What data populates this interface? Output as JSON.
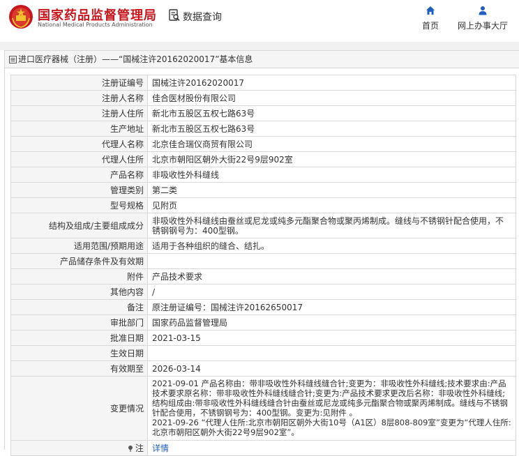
{
  "header": {
    "site_title": "国家药品监督管理局",
    "site_subtitle": "National Medical Products Administration",
    "query_label": "数据查询",
    "nav": [
      {
        "label": "首页",
        "icon": "home-icon"
      },
      {
        "label": "网上办事大厅",
        "icon": "user-icon"
      }
    ]
  },
  "panel": {
    "title": "进口医疗器械（注册）——“国械注许20162020017”基本信息",
    "rows": [
      {
        "key": "注册证编号",
        "value": "国械注许20162020017"
      },
      {
        "key": "注册人名称",
        "value": "佳合医材股份有限公司"
      },
      {
        "key": "注册人住所",
        "value": "新北市五股区五权七路63号"
      },
      {
        "key": "生产地址",
        "value": "新北市五股区五权七路63号"
      },
      {
        "key": "代理人名称",
        "value": "北京佳合瑞仪商贸有限公司"
      },
      {
        "key": "代理人住所",
        "value": "北京市朝阳区朝外大街22号9层902室"
      },
      {
        "key": "产品名称",
        "value": "非吸收性外科缝线"
      },
      {
        "key": "管理类别",
        "value": "第二类"
      },
      {
        "key": "型号规格",
        "value": "见附页"
      },
      {
        "key": "结构及组成/主要组成成分",
        "value": "非吸收性外科缝线由蚕丝或尼龙或纯多元酯聚合物或聚丙烯制成。缝线与不锈钢针配合使用，不锈钢钢号为：400型钢。"
      },
      {
        "key": "适用范围/预期用途",
        "value": "适用于各种组织的缝合、结扎。"
      },
      {
        "key": "产品储存条件及有效期",
        "value": ""
      },
      {
        "key": "附件",
        "value": "产品技术要求"
      },
      {
        "key": "其他内容",
        "value": "/"
      },
      {
        "key": "备注",
        "value": "原注册证编号：国械注许20162650017"
      },
      {
        "key": "审批部门",
        "value": "国家药品监督管理局"
      },
      {
        "key": "批准日期",
        "value": "2021-03-15"
      },
      {
        "key": "生效日期",
        "value": ""
      },
      {
        "key": "有效期至",
        "value": "2026-03-14"
      },
      {
        "key": "变更情况",
        "value": "2021-09-01 产品名称由：带非吸收性外科缝线缝合针;变更为：非吸收性外科缝线;技术要求由:产品技术要求原名称：带非吸收性外科缝线缝合针;变更为:产品技术要求更改后名称：非吸收性外科缝线;结构组成由:带非吸收性外科缝线缝合针由蚕丝或尼龙或纯多元酯聚合物或聚丙烯制成。缝线与不锈钢针配合使用，不锈钢钢号为：400型钢。变更为:见附件 。\n2021-09-26 “代理人住所:北京市朝阳区朝外大街10号（A1区）8层808-809室”变更为“代理人住所:北京市朝阳区朝外大街22号9层902室”。"
      },
      {
        "key": "注",
        "value": "详情"
      }
    ]
  },
  "colors": {
    "brand": "#c8161d",
    "nav_icon": "#1f5fbf",
    "link": "#1f5fbf"
  }
}
